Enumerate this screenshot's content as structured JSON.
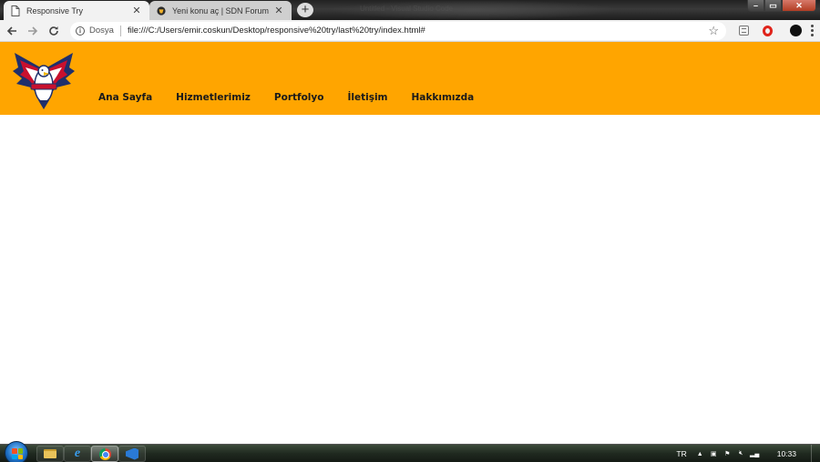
{
  "browser": {
    "tabs": [
      {
        "title": "Responsive Try",
        "favicon": "page-icon",
        "active": true
      },
      {
        "title": "Yeni konu aç | SDN Forum",
        "favicon": "sdn-forum-icon",
        "active": false
      }
    ],
    "window_title_ghost": "Untitled - Visual Studio Code",
    "address": {
      "scheme_label": "Dosya",
      "url": "file:///C:/Users/emir.coskun/Desktop/responsive%20try/last%20try/index.html#"
    },
    "icons": {
      "back": "arrow-left-icon",
      "forward": "arrow-right-icon",
      "reload": "reload-icon",
      "info": "info-icon",
      "bookmark": "star-icon",
      "extension": "extension-icon",
      "opera": "opera-icon",
      "profile": "profile-icon",
      "menu": "kebab-menu-icon"
    }
  },
  "site": {
    "header_color": "#ffa500",
    "logo": "eagle-logo",
    "nav": [
      {
        "label": "Ana Sayfa"
      },
      {
        "label": "Hizmetlerimiz"
      },
      {
        "label": "Portfolyo"
      },
      {
        "label": "İletişim"
      },
      {
        "label": "Hakkımızda"
      }
    ]
  },
  "taskbar": {
    "apps": [
      "file-explorer-icon",
      "internet-explorer-icon",
      "chrome-icon",
      "visual-studio-icon"
    ],
    "language": "TR",
    "clock": "10:33"
  }
}
